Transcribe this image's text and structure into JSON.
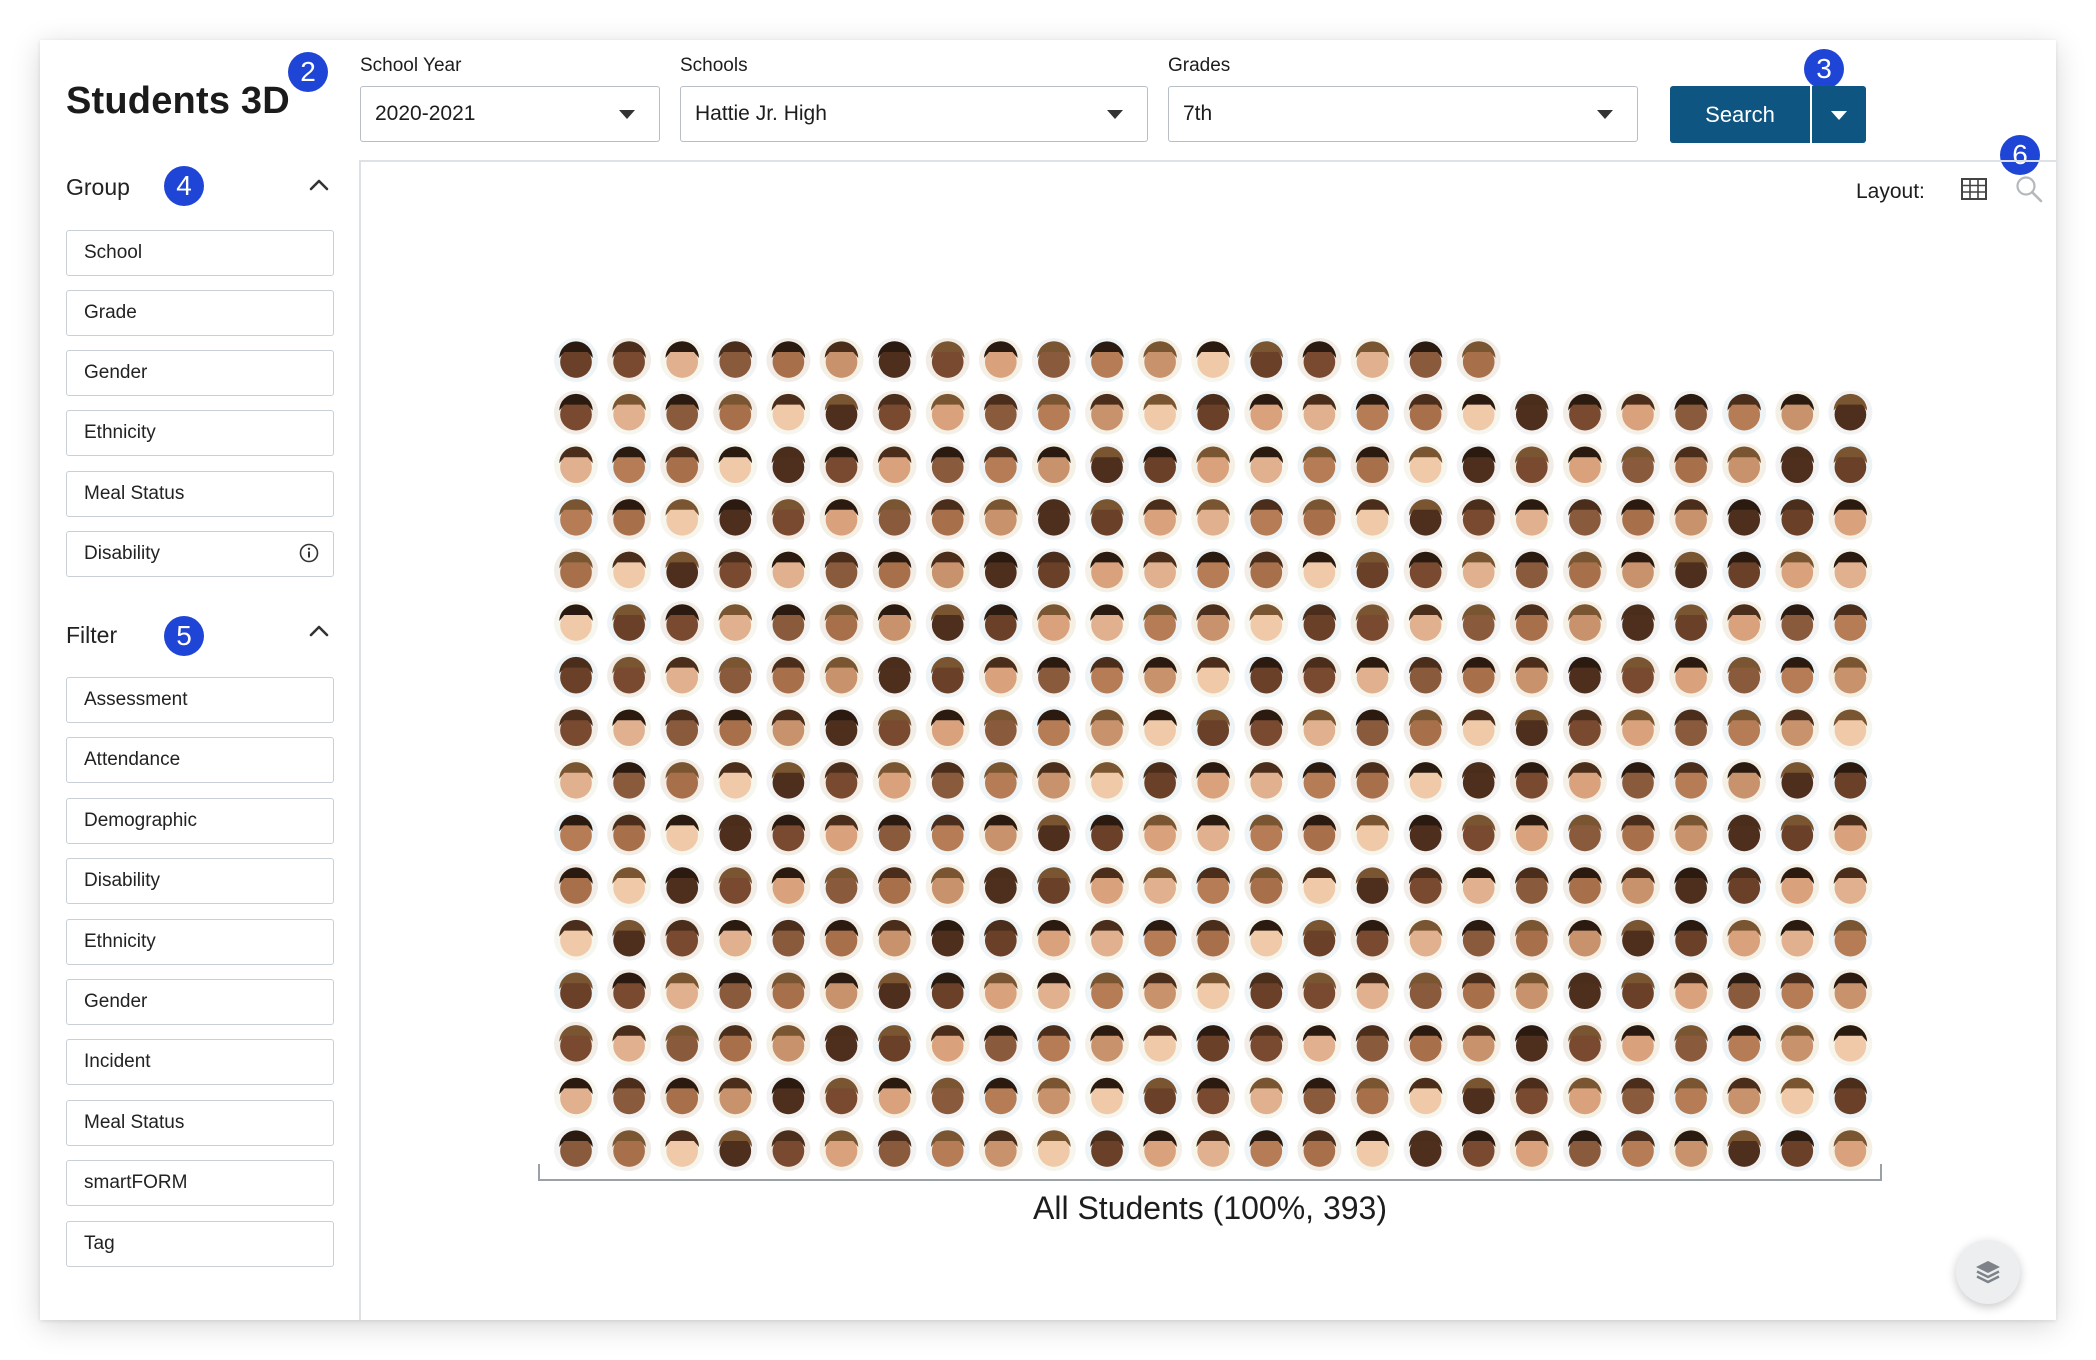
{
  "app": {
    "title": "Students 3D"
  },
  "steps": {
    "school_year": "2",
    "search": "3",
    "group": "4",
    "filter": "5",
    "layout": "6"
  },
  "toolbar": {
    "school_year": {
      "label": "School Year",
      "value": "2020-2021"
    },
    "schools": {
      "label": "Schools",
      "value": "Hattie Jr. High"
    },
    "grades": {
      "label": "Grades",
      "value": "7th"
    },
    "search_label": "Search"
  },
  "sidebar": {
    "group": {
      "heading": "Group",
      "items": [
        "School",
        "Grade",
        "Gender",
        "Ethnicity",
        "Meal Status",
        "Disability"
      ]
    },
    "filter": {
      "heading": "Filter",
      "items": [
        "Assessment",
        "Attendance",
        "Demographic",
        "Disability",
        "Ethnicity",
        "Gender",
        "Incident",
        "Meal Status",
        "smartFORM",
        "Tag"
      ]
    }
  },
  "main": {
    "layout_label": "Layout:",
    "group_label": "All Students (100%, 393)",
    "student_count": 393,
    "columns": 25
  },
  "colors": {
    "accent": "#0f5581",
    "badge": "#1f45d6",
    "border": "#c9cfd6"
  },
  "icons": {
    "collapse": "chevron-up-icon",
    "select": "caret-down-icon",
    "info": "info-icon",
    "layout": "grid-table-icon",
    "zoom": "magnifier-icon",
    "layers": "layers-icon"
  }
}
